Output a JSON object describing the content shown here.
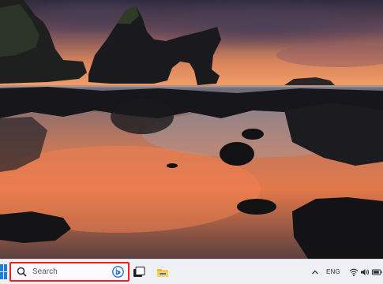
{
  "desktop": {
    "wallpaper": "sea-arch-rock-sunset",
    "colors": {
      "sky_top": "#2d2a3c",
      "sky_glow": "#f08a55",
      "water_glow": "#e87a4a",
      "rock": "#15151a"
    }
  },
  "taskbar": {
    "background": "#eef0f4",
    "start_icon": "windows-logo-icon",
    "search": {
      "label": "Search",
      "highlight_color": "#e2232a",
      "icons": [
        "search-icon",
        "bing-icon"
      ]
    },
    "pinned_apps": [
      "task-view-icon",
      "file-explorer-icon"
    ],
    "tray": {
      "language": "ENG",
      "icons": [
        "wifi-icon",
        "volume-icon",
        "battery-icon"
      ]
    }
  }
}
